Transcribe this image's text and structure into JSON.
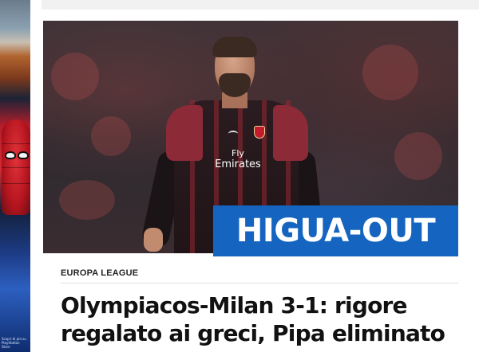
{
  "article": {
    "overlay_headline": "HIGUA-OUT",
    "category": "EUROPA LEAGUE",
    "title_line1": "Olympiacos-Milan 3-1: rigore",
    "title_line2": "regalato ai greci, Pipa eliminato"
  },
  "hero_image": {
    "sponsor_line1": "Fly",
    "sponsor_line2": "Emirates"
  },
  "side_ad": {
    "fine_print": "Scopri di più su PlayStation Store"
  },
  "colors": {
    "overlay_bg": "#1565c0",
    "jersey_primary": "#201417",
    "jersey_accent": "#8c2a38"
  }
}
